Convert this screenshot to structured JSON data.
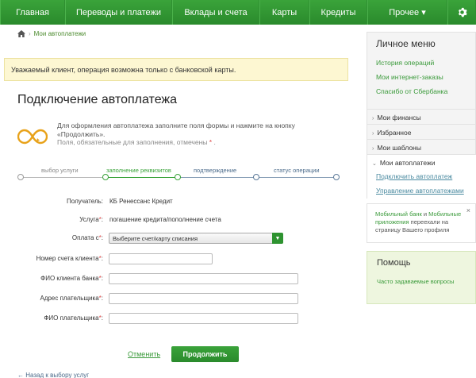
{
  "nav": {
    "items": [
      "Главная",
      "Переводы и платежи",
      "Вклады и счета",
      "Карты",
      "Кредиты",
      "Прочее ▾"
    ],
    "settings_icon": "gear-icon"
  },
  "breadcrumb": {
    "home_icon": "home-icon",
    "separator": "›",
    "current": "Мои автоплатежи"
  },
  "warning": "Уважаемый клиент, операция возможна только с банковской карты.",
  "title": "Подключение автоплатежа",
  "intro": {
    "icon": "autopay-infinity-icon",
    "text": "Для оформления автоплатежа заполните поля формы и нажмите на кнопку «Продолжить».",
    "required_note": "Поля, обязательные для заполнения, отмечены",
    "star": "*",
    "dot": "."
  },
  "steps": [
    "выбор услуги",
    "заполнение реквизитов",
    "подтверждение",
    "статус операции"
  ],
  "form": {
    "recipient_label": "Получатель:",
    "recipient_value": "КБ Ренессанс Кредит",
    "service_label": "Услуга",
    "service_value": "погашение кредита/пополнение счета",
    "payment_label": "Оплата с",
    "payment_select": "Выберите счет/карту списания",
    "account_label": "Номер счета клиента",
    "bank_client_label": "ФИО клиента банка",
    "address_label": "Адрес плательщика",
    "payer_label": "ФИО плательщика",
    "star": "*",
    "colon": ":"
  },
  "buttons": {
    "cancel": "Отменить",
    "continue": "Продолжить"
  },
  "back_link": "← Назад к выбору услуг",
  "personal_menu": {
    "title": "Личное меню",
    "links": [
      "История операций",
      "Мои интернет-заказы",
      "Спасибо от Сбербанка"
    ],
    "sections": [
      "Мои финансы",
      "Избранное",
      "Мои шаблоны"
    ],
    "open_section": "Мои автоплатежи",
    "sub_links": [
      "Подключить автоплатеж",
      "Управление автоплатежами"
    ]
  },
  "promo": {
    "part1": "Мобильный банк",
    "part2": " и ",
    "part3": "Мобильные приложения",
    "part4": " переехали на страницу Вашего профиля",
    "close": "×"
  },
  "help": {
    "title": "Помощь",
    "link": "Часто задаваемые вопросы"
  },
  "colors": {
    "accent": "#2e9330",
    "warning_bg": "#fdf7d2",
    "help_bg": "#eef6df"
  }
}
